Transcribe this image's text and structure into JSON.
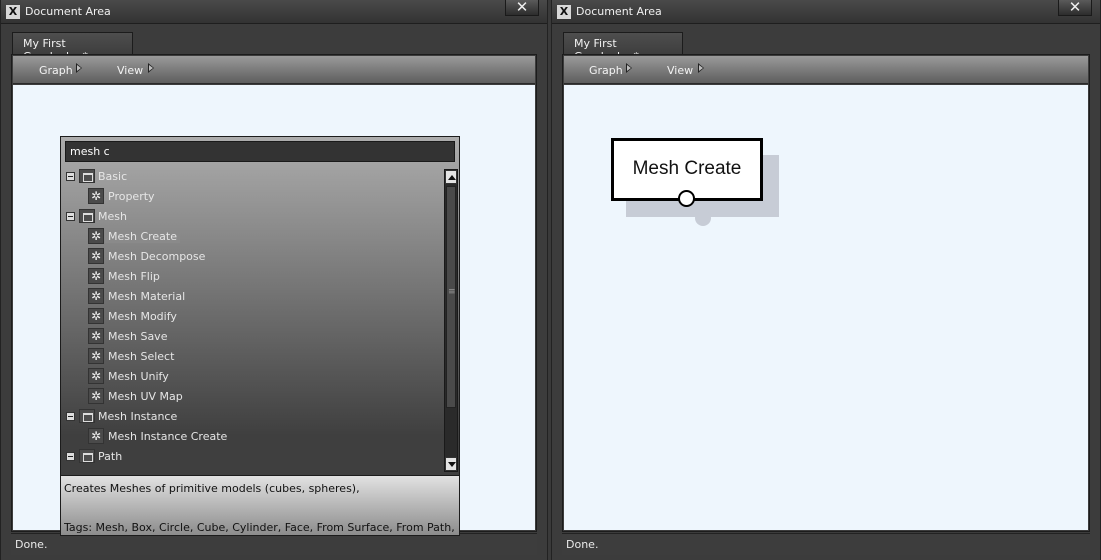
{
  "left_window": {
    "title": "Document Area",
    "app_icon": "X",
    "close_label": "✕",
    "tab": "My First Graph.slxg*",
    "menu": {
      "graph": "Graph",
      "view": "View"
    },
    "status": "Done.",
    "picker": {
      "search_value": "mesh c",
      "items": [
        {
          "type": "folder",
          "label": "Basic"
        },
        {
          "type": "node",
          "label": "Property"
        },
        {
          "type": "folder",
          "label": "Mesh"
        },
        {
          "type": "node",
          "label": "Mesh Create",
          "selected": true
        },
        {
          "type": "node",
          "label": "Mesh Decompose"
        },
        {
          "type": "node",
          "label": "Mesh Flip"
        },
        {
          "type": "node",
          "label": "Mesh Material"
        },
        {
          "type": "node",
          "label": "Mesh Modify"
        },
        {
          "type": "node",
          "label": "Mesh Save"
        },
        {
          "type": "node",
          "label": "Mesh Select"
        },
        {
          "type": "node",
          "label": "Mesh Unify"
        },
        {
          "type": "node",
          "label": "Mesh UV Map"
        },
        {
          "type": "folder",
          "label": "Mesh Instance"
        },
        {
          "type": "node",
          "label": "Mesh Instance Create"
        },
        {
          "type": "folder",
          "label": "Path"
        }
      ],
      "description": "Creates Meshes of primitive models (cubes, spheres),",
      "tags": "Tags: Mesh, Box, Circle, Cube, Cylinder, Face, From Surface, From Path, Random"
    }
  },
  "right_window": {
    "title": "Document Area",
    "app_icon": "X",
    "close_label": "✕",
    "tab": "My First Graph.slxg*",
    "menu": {
      "graph": "Graph",
      "view": "View"
    },
    "status": "Done.",
    "node": {
      "title": "Mesh Create"
    }
  }
}
